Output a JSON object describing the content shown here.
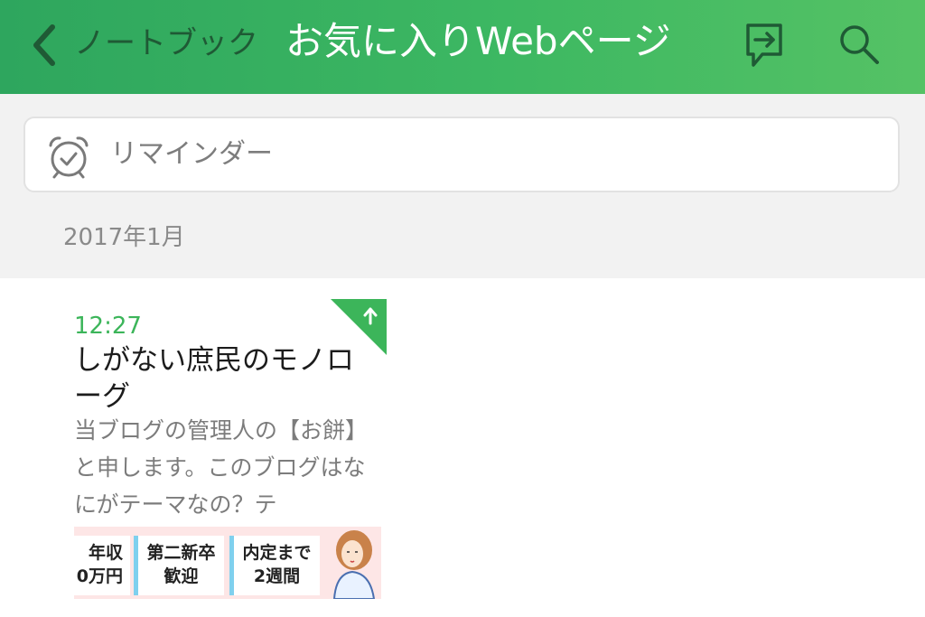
{
  "header": {
    "back_label": "ノートブック",
    "title": "お気に入りWebページ",
    "share_icon": "share-note-icon",
    "search_icon": "search-icon"
  },
  "reminder": {
    "label": "リマインダー",
    "icon": "alarm-clock-icon"
  },
  "section": {
    "month": "2017年1月"
  },
  "note": {
    "time": "12:27",
    "title": "しがない庶民のモノローグ",
    "snippet": "当ブログの管理人の【お餅】と申します。このブログはなにがテーマなの？テ",
    "corner_icon": "up-arrow-icon",
    "thumbnail": {
      "tile1": [
        "年収",
        "0万円"
      ],
      "tile2": [
        "第二新卒",
        "歓迎"
      ],
      "tile3": [
        "内定まで",
        "2週間"
      ]
    }
  },
  "colors": {
    "header_start": "#2ea65e",
    "header_end": "#55c265",
    "accent_green": "#3cb55a",
    "band_gray": "#f2f2f2"
  }
}
